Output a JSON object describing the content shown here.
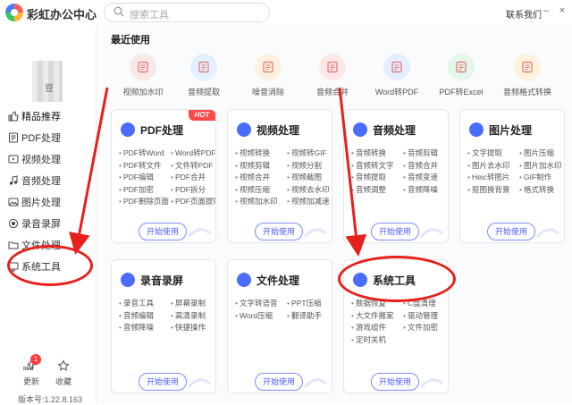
{
  "app": {
    "title": "彩虹办公中心",
    "contact": "联系我们"
  },
  "search": {
    "placeholder": "搜索工具"
  },
  "user": {
    "name": "豆"
  },
  "sidebar": {
    "items": [
      {
        "label": "精品推荐",
        "icon": "thumbs-up-icon"
      },
      {
        "label": "PDF处理",
        "icon": "pdf-icon"
      },
      {
        "label": "视频处理",
        "icon": "video-icon"
      },
      {
        "label": "音频处理",
        "icon": "music-icon"
      },
      {
        "label": "图片处理",
        "icon": "image-icon"
      },
      {
        "label": "录音录屏",
        "icon": "record-icon"
      },
      {
        "label": "文件处理",
        "icon": "folder-icon"
      },
      {
        "label": "系统工具",
        "icon": "system-icon"
      }
    ],
    "update_label": "更新",
    "update_badge": "1",
    "new_badge": "NEW",
    "favorite_label": "收藏",
    "version": "版本号:1.22.8.163"
  },
  "recent": {
    "title": "最近使用",
    "items": [
      {
        "label": "视频加水印",
        "color": "#fbe9e7",
        "icon": "video-watermark-icon"
      },
      {
        "label": "音频提取",
        "color": "#e3f0fd",
        "icon": "audio-extract-icon"
      },
      {
        "label": "噪音消除",
        "color": "#fdf1e0",
        "icon": "noise-remove-icon"
      },
      {
        "label": "音频合并",
        "color": "#fde7e7",
        "icon": "audio-merge-icon"
      },
      {
        "label": "Word转PDF",
        "color": "#e3efff",
        "icon": "word-to-pdf-icon"
      },
      {
        "label": "PDF转Excel",
        "color": "#e3f7ea",
        "icon": "pdf-to-excel-icon"
      },
      {
        "label": "音频格式转换",
        "color": "#fdf3dc",
        "icon": "audio-convert-icon"
      }
    ]
  },
  "cards": [
    {
      "title": "PDF处理",
      "hot": "HOT",
      "icon_color": "#4a6cff",
      "icon": "pdf-icon",
      "items": [
        "PDF转Word",
        "Word转PDF",
        "PDF转文件",
        "文件转PDF",
        "PDF编辑",
        "PDF合并",
        "PDF加密",
        "PDF拆分",
        "PDF删除页面",
        "PDF页面提取"
      ]
    },
    {
      "title": "视频处理",
      "hot": "",
      "icon_color": "#4a6cff",
      "icon": "video-icon",
      "items": [
        "视频转换",
        "视频转GIF",
        "视频剪辑",
        "视频分割",
        "视频合并",
        "视频截图",
        "视频压缩",
        "视频去水印",
        "视频加水印",
        "视频加减速"
      ]
    },
    {
      "title": "音频处理",
      "hot": "",
      "icon_color": "#4a6cff",
      "icon": "music-icon",
      "items": [
        "音频转换",
        "音频剪辑",
        "音频转文字",
        "音频合并",
        "音频提取",
        "音频变速",
        "音频调整",
        "音频降噪"
      ]
    },
    {
      "title": "图片处理",
      "hot": "",
      "icon_color": "#4a6cff",
      "icon": "image-icon",
      "items": [
        "文字提取",
        "图片压缩",
        "图片去水印",
        "图片加水印",
        "Heic转图片",
        "GIF制作",
        "抠图换背景",
        "格式转换"
      ]
    },
    {
      "title": "录音录屏",
      "hot": "",
      "icon_color": "#4a6cff",
      "icon": "mic-icon",
      "items": [
        "录音工具",
        "屏幕录制",
        "音频编辑",
        "高清录制",
        "音频降噪",
        "快捷操作"
      ]
    },
    {
      "title": "文件处理",
      "hot": "",
      "icon_color": "#4a6cff",
      "icon": "file-icon",
      "items": [
        "文字转语音",
        "PPT压缩",
        "Word压缩",
        "翻译助手"
      ]
    },
    {
      "title": "系统工具",
      "hot": "",
      "icon_color": "#4a6cff",
      "icon": "gear-icon",
      "items": [
        "数据恢复",
        "C盘清理",
        "大文件搬家",
        "驱动管理",
        "游戏组件",
        "文件加密",
        "定时关机"
      ]
    }
  ],
  "card_button_label": "开始使用",
  "colors": {
    "accent": "#4a6cff",
    "annotation": "#e8201c",
    "hot": "#ff4a4a"
  }
}
